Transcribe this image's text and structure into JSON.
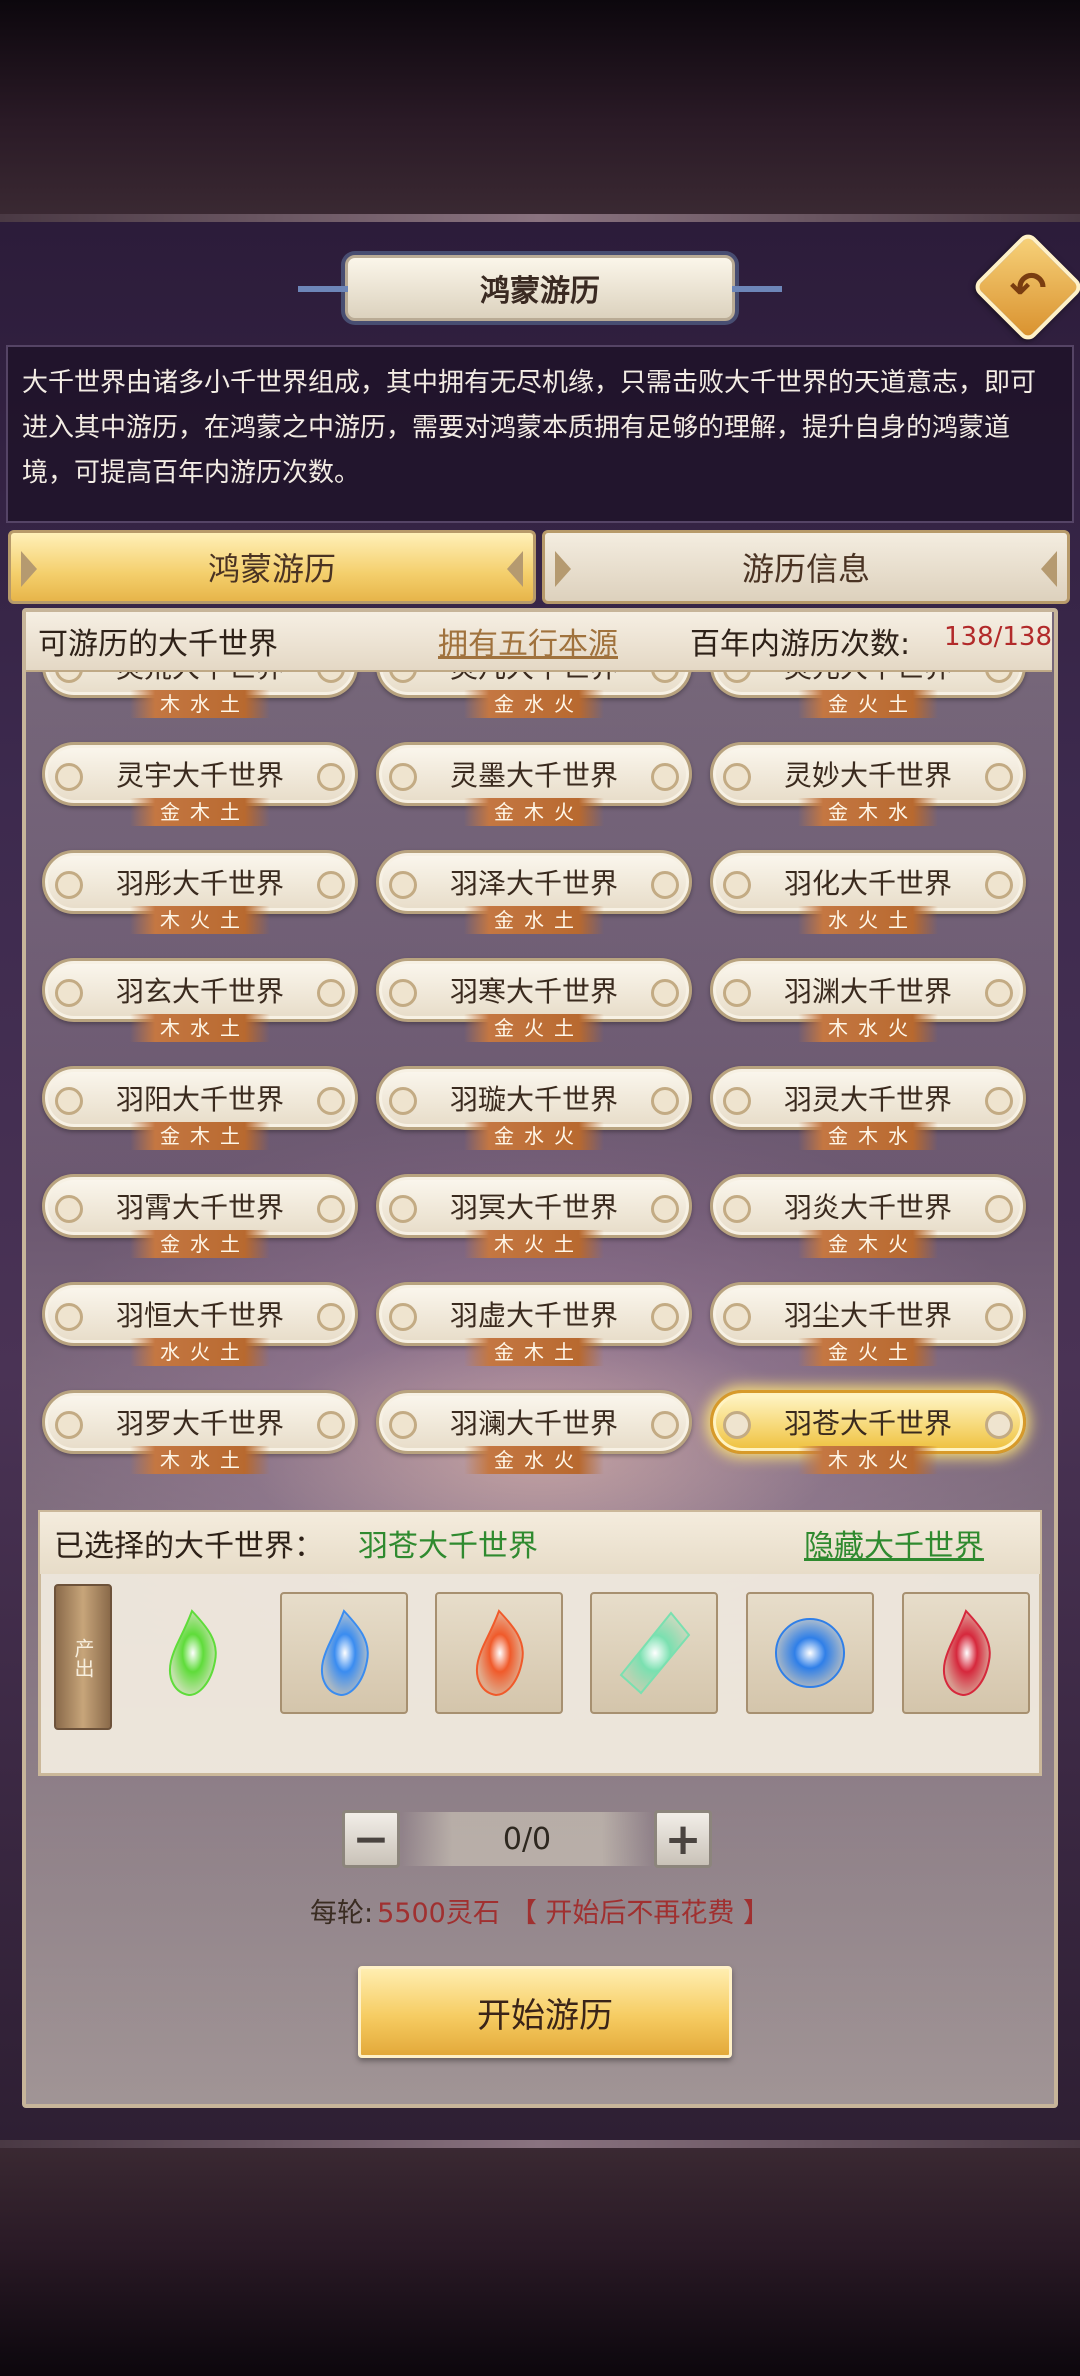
{
  "header": {
    "title": "鸿蒙游历",
    "back_icon": "back-arrow-icon"
  },
  "description": "大千世界由诸多小千世界组成，其中拥有无尽机缘，只需击败大千世界的天道意志，即可进入其中游历，在鸿蒙之中游历，需要对鸿蒙本质拥有足够的理解，提升自身的鸿蒙道境，可提高百年内游历次数。",
  "tabs": [
    {
      "label": "鸿蒙游历",
      "active": true
    },
    {
      "label": "游历信息",
      "active": false
    }
  ],
  "list_header": {
    "title": "可游历的大千世界",
    "source_link": "拥有五行本源",
    "count_label": "百年内游历次数:",
    "count_value": "138/138"
  },
  "worlds": [
    {
      "name": "灵荒大千世界",
      "elements": "木水土"
    },
    {
      "name": "灵凡大千世界",
      "elements": "金水火"
    },
    {
      "name": "灵元大千世界",
      "elements": "金火土"
    },
    {
      "name": "灵宇大千世界",
      "elements": "金木土"
    },
    {
      "name": "灵墨大千世界",
      "elements": "金木火"
    },
    {
      "name": "灵妙大千世界",
      "elements": "金木水"
    },
    {
      "name": "羽彤大千世界",
      "elements": "木火土"
    },
    {
      "name": "羽泽大千世界",
      "elements": "金水土"
    },
    {
      "name": "羽化大千世界",
      "elements": "水火土"
    },
    {
      "name": "羽玄大千世界",
      "elements": "木水土"
    },
    {
      "name": "羽寒大千世界",
      "elements": "金火土"
    },
    {
      "name": "羽渊大千世界",
      "elements": "木水火"
    },
    {
      "name": "羽阳大千世界",
      "elements": "金木土"
    },
    {
      "name": "羽璇大千世界",
      "elements": "金水火"
    },
    {
      "name": "羽灵大千世界",
      "elements": "金木水"
    },
    {
      "name": "羽霄大千世界",
      "elements": "金水土"
    },
    {
      "name": "羽冥大千世界",
      "elements": "木火土"
    },
    {
      "name": "羽炎大千世界",
      "elements": "金木火"
    },
    {
      "name": "羽恒大千世界",
      "elements": "水火土"
    },
    {
      "name": "羽虚大千世界",
      "elements": "金木土"
    },
    {
      "name": "羽尘大千世界",
      "elements": "金火土"
    },
    {
      "name": "羽罗大千世界",
      "elements": "木水土"
    },
    {
      "name": "羽澜大千世界",
      "elements": "金水火"
    },
    {
      "name": "羽苍大千世界",
      "elements": "木水火",
      "selected": true
    }
  ],
  "selection": {
    "label": "已选择的大千世界：",
    "value": "羽苍大千世界",
    "hide_link": "隐藏大千世界",
    "produce_label": "产出",
    "items": [
      {
        "icon": "green-wood-essence-icon",
        "color": "#5fdc3a"
      },
      {
        "icon": "blue-water-essence-icon",
        "color": "#3a8cf0"
      },
      {
        "icon": "red-fire-essence-icon",
        "color": "#f05a2a"
      },
      {
        "icon": "green-crystal-icon",
        "color": "#7ae0b0"
      },
      {
        "icon": "blue-orb-icon",
        "color": "#2f7fe8"
      },
      {
        "icon": "red-flame-icon",
        "color": "#d6283c"
      }
    ]
  },
  "stepper": {
    "value": "0/0",
    "minus": "−",
    "plus": "+"
  },
  "cost": {
    "label": "每轮:",
    "value": "5500灵石",
    "note": "【 开始后不再花费 】"
  },
  "start_button": "开始游历"
}
